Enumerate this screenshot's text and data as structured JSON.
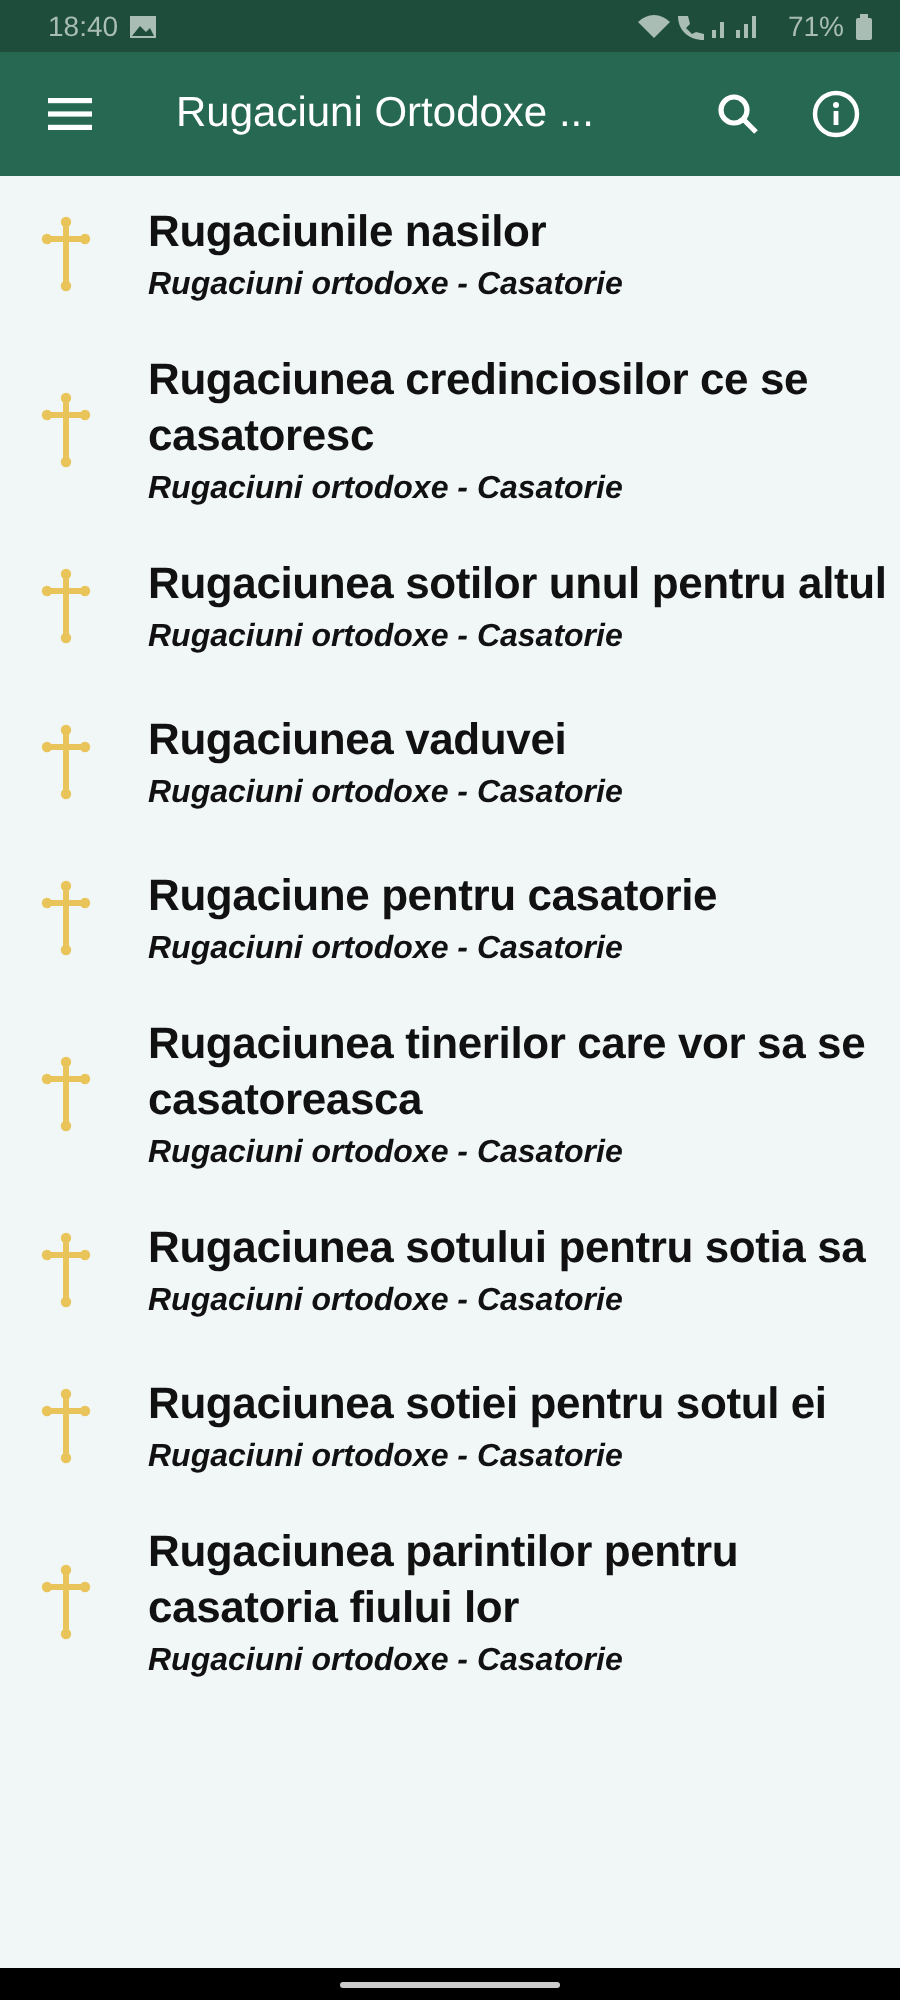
{
  "status_bar": {
    "time": "18:40",
    "battery": "71%"
  },
  "app_bar": {
    "title": "Rugaciuni Ortodoxe ..."
  },
  "items": [
    {
      "title": "Rugaciunile nasilor",
      "subtitle": "Rugaciuni ortodoxe - Casatorie"
    },
    {
      "title": "Rugaciunea credinciosilor ce se casatoresc",
      "subtitle": "Rugaciuni ortodoxe - Casatorie"
    },
    {
      "title": "Rugaciunea sotilor unul pentru altul",
      "subtitle": "Rugaciuni ortodoxe - Casatorie"
    },
    {
      "title": "Rugaciunea vaduvei",
      "subtitle": "Rugaciuni ortodoxe - Casatorie"
    },
    {
      "title": "Rugaciune pentru casatorie",
      "subtitle": "Rugaciuni ortodoxe - Casatorie"
    },
    {
      "title": "Rugaciunea tinerilor care vor sa se casatoreasca",
      "subtitle": "Rugaciuni ortodoxe - Casatorie"
    },
    {
      "title": "Rugaciunea sotului pentru sotia sa",
      "subtitle": "Rugaciuni ortodoxe - Casatorie"
    },
    {
      "title": "Rugaciunea sotiei pentru sotul ei",
      "subtitle": "Rugaciuni ortodoxe - Casatorie"
    },
    {
      "title": "Rugaciunea parintilor pentru casatoria fiului lor",
      "subtitle": "Rugaciuni ortodoxe - Casatorie"
    }
  ]
}
